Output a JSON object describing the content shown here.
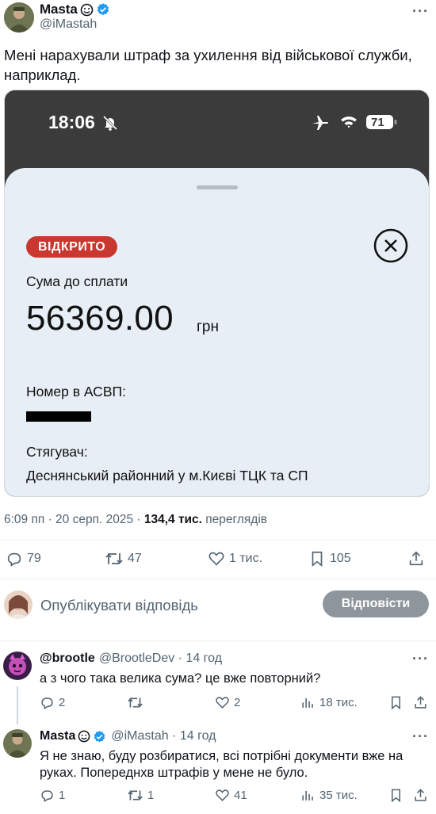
{
  "tweet": {
    "author_name": "Masta",
    "author_handle": "@iMastah",
    "more_label": "···",
    "text": "Мені нарахували штраф за ухилення від військової служби, наприклад.",
    "image": {
      "status_time": "18:06",
      "battery": "71",
      "badge": "ВІДКРИТО",
      "sum_label": "Сума до сплати",
      "amount": "56369.00",
      "currency": "грн",
      "asvp_label": "Номер в АСВП:",
      "collector_label": "Стягувач:",
      "collector_value": "Деснянський районний у м.Києві ТЦК та СП"
    },
    "timestamp": "6:09 пп · 20 серп. 2025 · ",
    "views_count": "134,4 тис.",
    "views_label": " переглядів",
    "actions": {
      "replies": "79",
      "retweets": "47",
      "likes": "1 тис.",
      "bookmarks": "105"
    }
  },
  "compose": {
    "placeholder": "Опублікувати відповідь",
    "button": "Відповісти"
  },
  "replies": [
    {
      "name": "@brootle",
      "handle": "@BrootleDev · 14 год",
      "text": "а з чого така велика сума? це вже повторний?",
      "replies": "2",
      "retweets": "",
      "likes": "2",
      "views": "18 тис."
    },
    {
      "name": "Masta",
      "handle": "@iMastah · 14 год",
      "text": "Я не знаю, буду розбиратися, всі потрібні документи вже на руках. Попереднхв штрафів у мене не було.",
      "replies": "1",
      "retweets": "1",
      "likes": "41",
      "views": "35 тис."
    }
  ],
  "colors": {
    "verified": "#1d9bf0",
    "badge_red": "#c8382f",
    "muted": "#536471"
  }
}
